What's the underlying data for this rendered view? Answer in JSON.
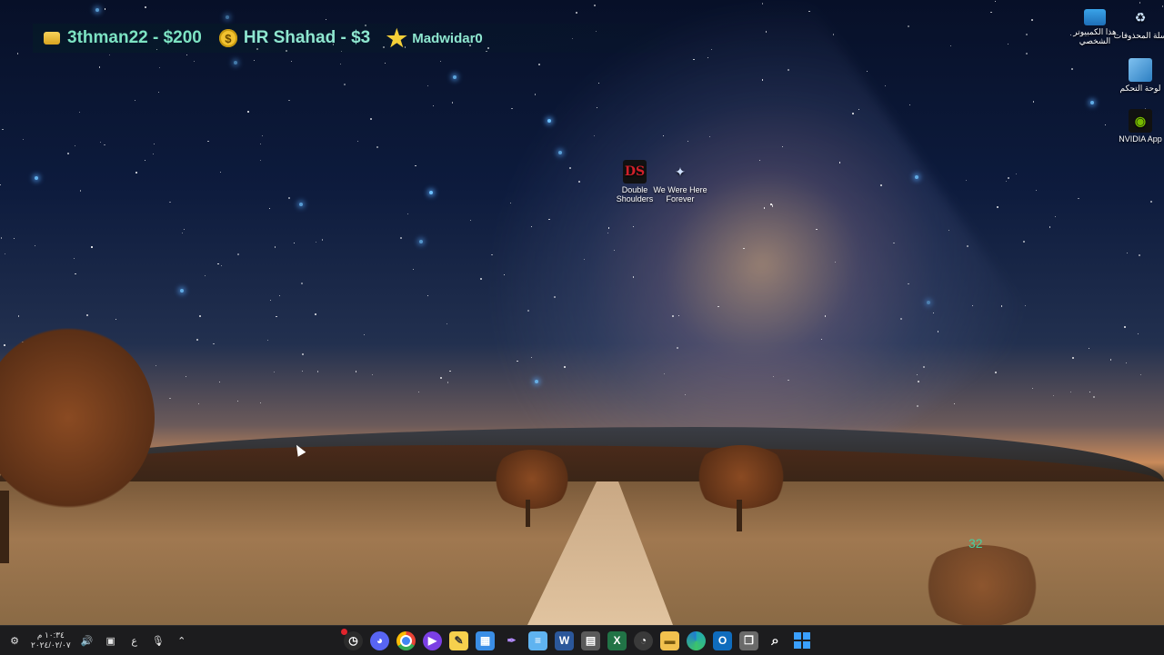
{
  "overlay": {
    "donors": [
      {
        "text": "3thman22 - $200",
        "icon": "gold-bar-icon"
      },
      {
        "text": "HR Shahad - $3",
        "icon": "dollar-coin-icon",
        "symbol": "$"
      },
      {
        "text": "Madwidar0",
        "icon": "star-icon"
      }
    ],
    "counter": "32"
  },
  "desktop": {
    "icons": [
      {
        "label": "سلة المحذوفات",
        "icon": "recycle-bin-icon"
      },
      {
        "label": "هذا الكمبيوتر الشخصي",
        "icon": "this-pc-icon"
      },
      {
        "label": "لوحة التحكم",
        "icon": "control-panel-icon"
      },
      {
        "label": "NVIDIA App",
        "icon": "nvidia-icon"
      },
      {
        "label": "Double Shoulders",
        "icon": "double-shoulders-icon",
        "glyph": "DS"
      },
      {
        "label": "We Were Here Forever",
        "icon": "we-were-here-forever-icon"
      }
    ]
  },
  "taskbar": {
    "clock_time": "١٠:٣٤ م",
    "clock_date": "٢٠٢٤/٠٢/٠٧",
    "language": "ع",
    "tray": [
      "notification-icon",
      "display-icon",
      "volume-icon",
      "language-icon",
      "microphone-icon",
      "show-hidden-chevron-icon"
    ],
    "apps": [
      {
        "name": "clock-app",
        "color": "#2b2b2b"
      },
      {
        "name": "discord",
        "color": "#5865f2"
      },
      {
        "name": "chrome",
        "color": "#fbbc05"
      },
      {
        "name": "media-app",
        "color": "#7b3fe4"
      },
      {
        "name": "notes-app",
        "color": "#f6d04d"
      },
      {
        "name": "store",
        "color": "#3a8ee6"
      },
      {
        "name": "pen-app",
        "color": "#9b6cf0"
      },
      {
        "name": "notepad",
        "color": "#5fb3f0"
      },
      {
        "name": "word",
        "color": "#2b579a",
        "letter": "W"
      },
      {
        "name": "calculator",
        "color": "#5a5a5a"
      },
      {
        "name": "excel",
        "color": "#217346",
        "letter": "X"
      },
      {
        "name": "settings-app",
        "color": "#3a3a3a"
      },
      {
        "name": "file-explorer",
        "color": "#f2c14e"
      },
      {
        "name": "edge",
        "color": "#1fa7b8"
      },
      {
        "name": "outlook",
        "color": "#0f6cbd",
        "letter": "O"
      },
      {
        "name": "task-view",
        "color": "#6a6a6a"
      },
      {
        "name": "search",
        "color": "#1c1c1e"
      },
      {
        "name": "start",
        "color": "#3aa0ff"
      }
    ]
  }
}
